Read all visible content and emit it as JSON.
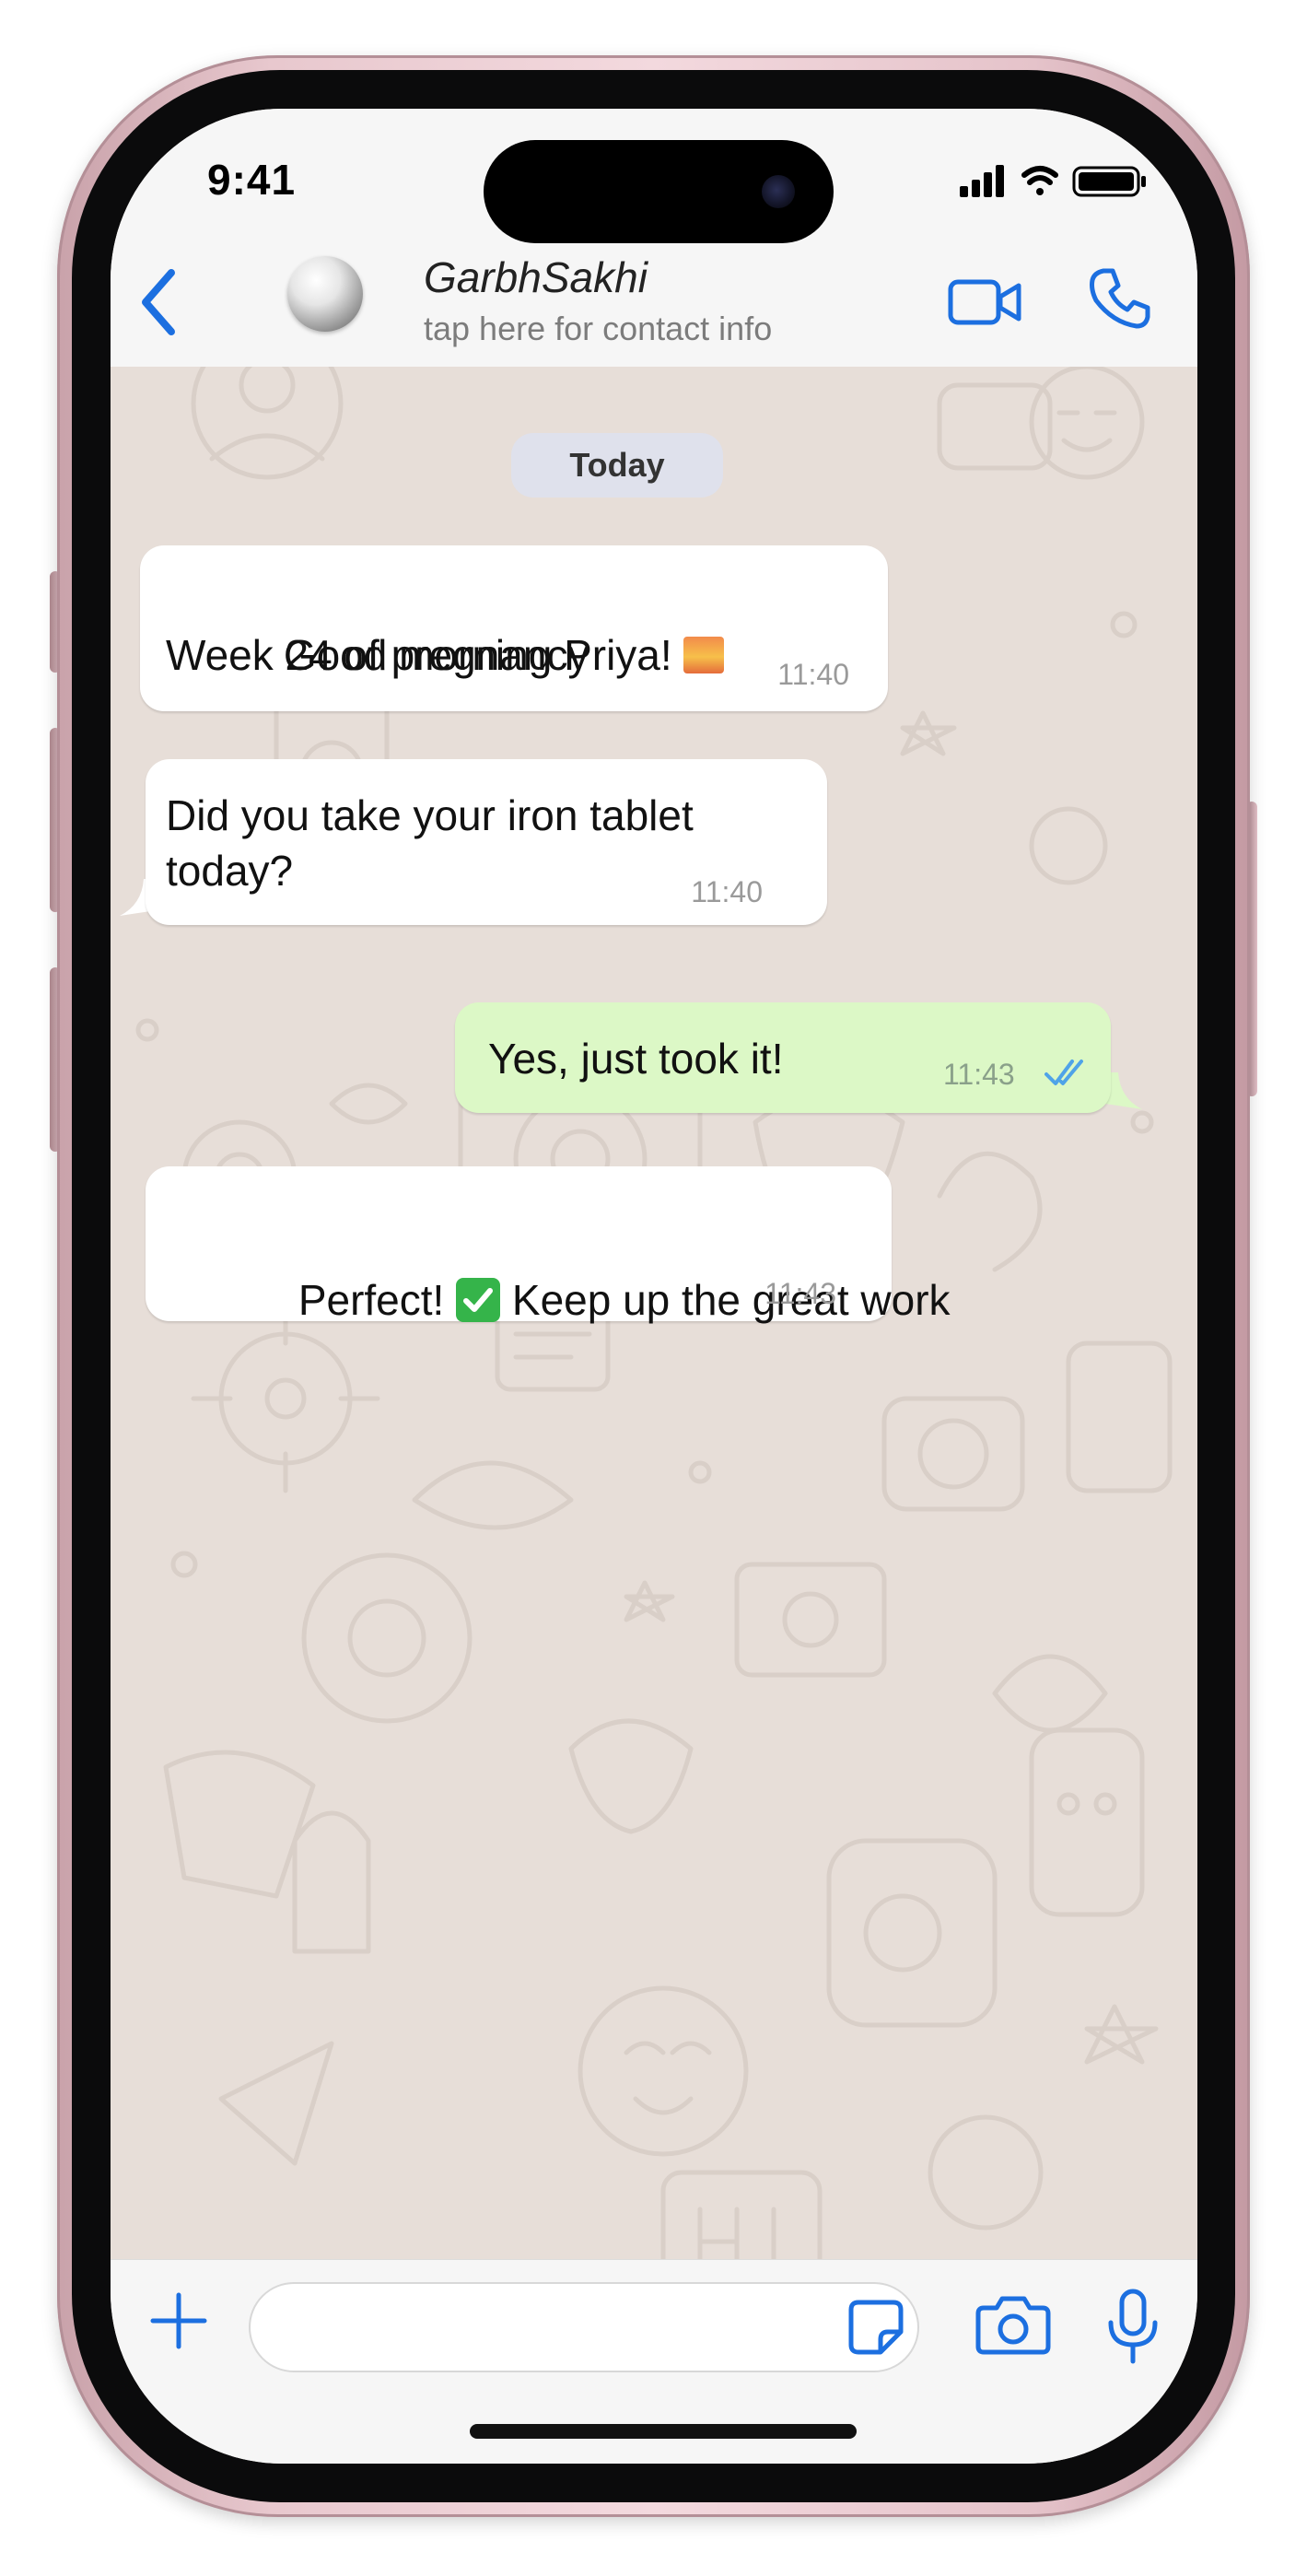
{
  "status_bar": {
    "time": "9:41"
  },
  "header": {
    "contact_name": "GarbhSakhi",
    "contact_subtitle": "tap here for contact info"
  },
  "chat": {
    "date_label": "Today",
    "messages": [
      {
        "direction": "incoming",
        "line1": "Good morning Priya!",
        "line1_emoji": "sunrise-emoji",
        "line2": "Week 24 of pregnancy",
        "time": "11:40"
      },
      {
        "direction": "incoming",
        "line1": "Did you take your iron tablet",
        "line2": "today?",
        "time": "11:40"
      },
      {
        "direction": "outgoing",
        "line1": "Yes, just took it!",
        "time": "11:43",
        "read_receipt": "double-check-icon"
      },
      {
        "direction": "incoming",
        "line1_before": "Perfect!",
        "line1_emoji": "check-mark-emoji",
        "line1_after": "Keep up the great work",
        "time": "11:43"
      }
    ]
  },
  "composer": {
    "input_value": "",
    "input_placeholder": ""
  },
  "colors": {
    "accent": "#1c6fe0",
    "chat_background": "#e7ded8",
    "outgoing_bubble": "#dcf8c6",
    "incoming_bubble": "#ffffff",
    "phone_frame": "#e8c8ce"
  }
}
